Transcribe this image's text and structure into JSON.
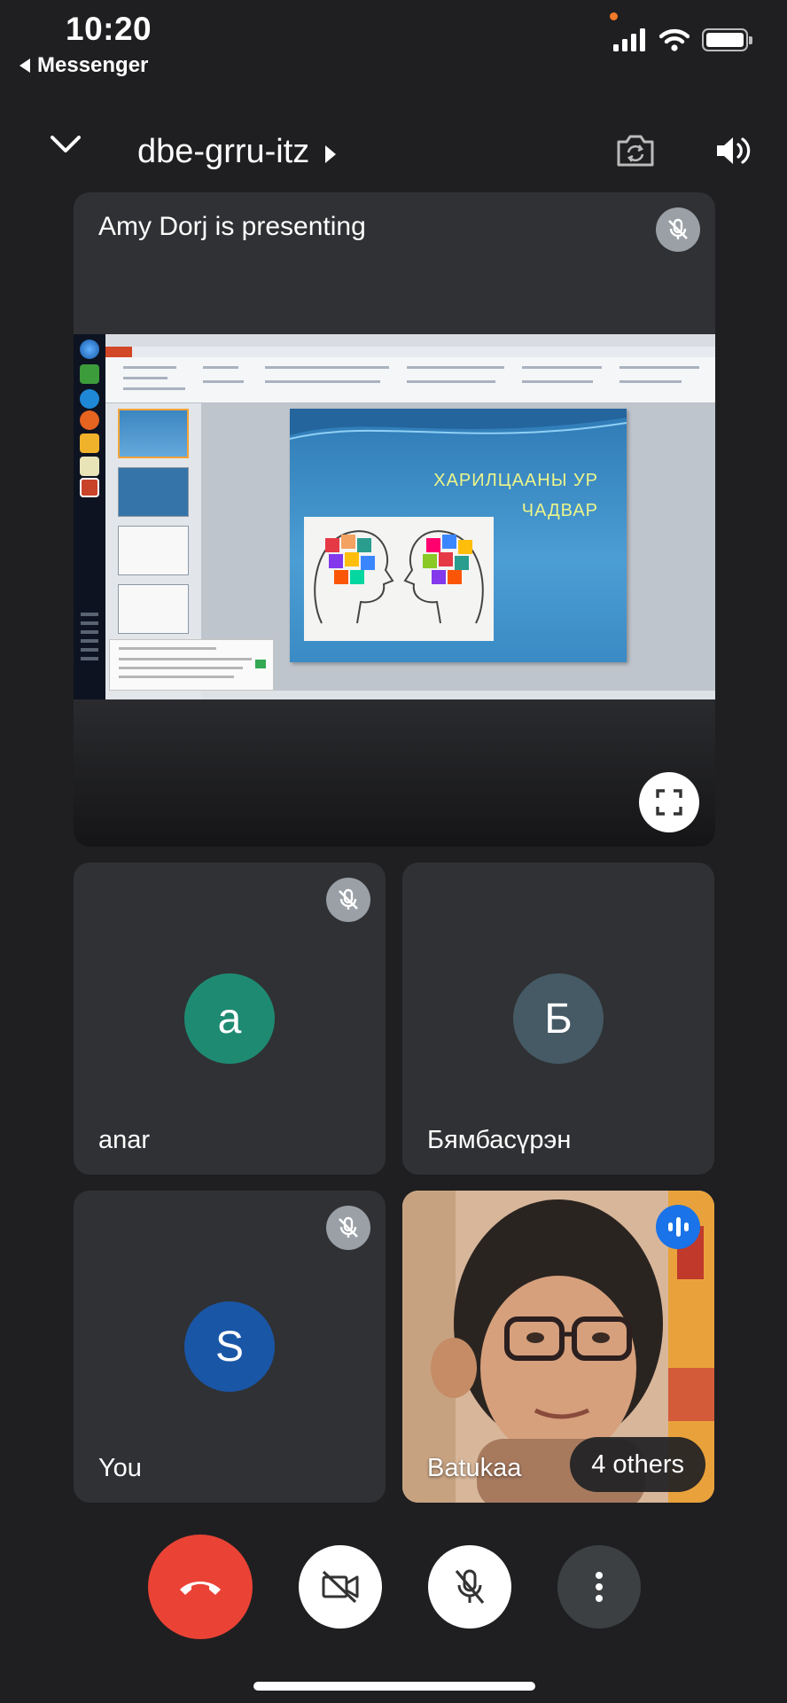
{
  "status_bar": {
    "time": "10:20",
    "back_app": "Messenger",
    "icons": [
      "signal-icon",
      "wifi-icon",
      "battery-icon"
    ]
  },
  "header": {
    "meeting_code": "dbe-grru-itz",
    "icons": [
      "chevron-down-icon",
      "switch-camera-icon",
      "speaker-icon"
    ]
  },
  "presentation": {
    "label": "Amy Dorj is presenting",
    "slide_title": "ХАРИЛЦААНЫ УР ЧАДВАР"
  },
  "participants": [
    {
      "name": "anar",
      "initial": "a",
      "avatar_color": "#1e8a72",
      "muted": true
    },
    {
      "name": "Бямбасүрэн",
      "initial": "Б",
      "avatar_color": "#455a64",
      "muted": false
    },
    {
      "name": "You",
      "initial": "S",
      "avatar_color": "#1a56a6",
      "muted": true
    },
    {
      "name": "Batukaa",
      "video": true,
      "speaking": true
    }
  ],
  "others": {
    "label": "4 others"
  },
  "controls": {
    "end_call_color": "#ea4335",
    "buttons": [
      "end-call",
      "camera-off",
      "mic-off",
      "more-options"
    ]
  },
  "colors": {
    "background": "#1f1f21",
    "tile": "#303134",
    "speaking": "#1a73e8"
  }
}
